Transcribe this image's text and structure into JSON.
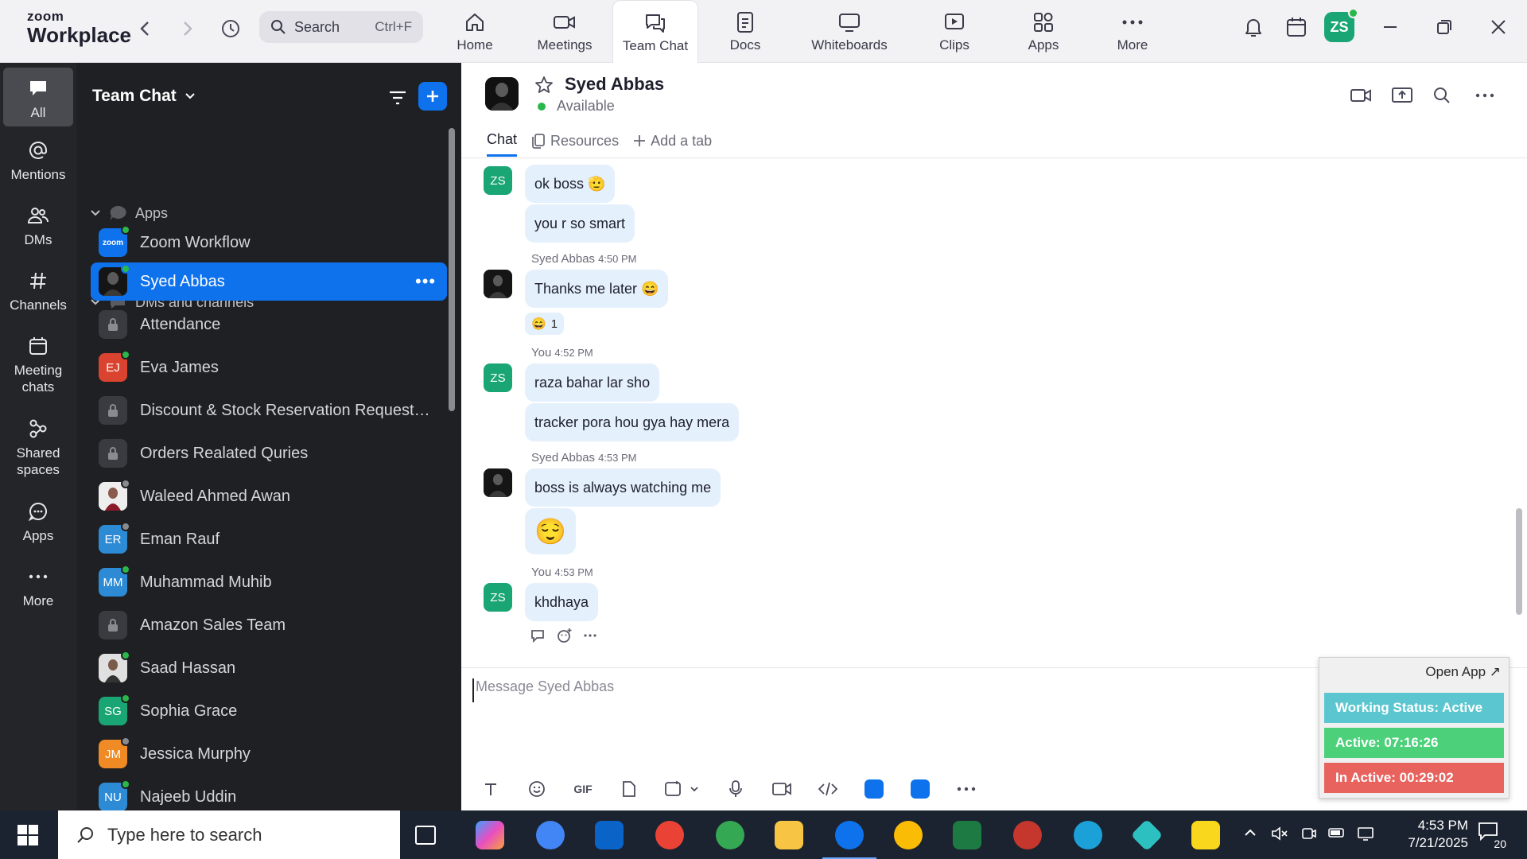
{
  "app": {
    "brand_line1": "zoom",
    "brand_line2": "Workplace",
    "search_label": "Search",
    "search_shortcut": "Ctrl+F",
    "user_initials": "ZS"
  },
  "top_tabs": [
    {
      "label": "Home",
      "icon": "home-icon"
    },
    {
      "label": "Meetings",
      "icon": "video-icon"
    },
    {
      "label": "Team Chat",
      "icon": "chat-icon",
      "active": true
    },
    {
      "label": "Docs",
      "icon": "document-icon"
    },
    {
      "label": "Whiteboards",
      "icon": "whiteboard-icon"
    },
    {
      "label": "Clips",
      "icon": "clips-icon"
    },
    {
      "label": "Apps",
      "icon": "apps-icon"
    },
    {
      "label": "More",
      "icon": "more-icon"
    }
  ],
  "rail": [
    {
      "label": "All",
      "icon": "chat-bubble-icon",
      "active": true
    },
    {
      "label": "Mentions",
      "icon": "at-icon"
    },
    {
      "label": "DMs",
      "icon": "people-icon"
    },
    {
      "label": "Channels",
      "icon": "hash-icon"
    },
    {
      "label_line1": "Meeting",
      "label_line2": "chats",
      "icon": "calendar-icon"
    },
    {
      "label_line1": "Shared",
      "label_line2": "spaces",
      "icon": "shared-icon"
    },
    {
      "label": "Apps",
      "icon": "apps-chat-icon"
    },
    {
      "label": "More",
      "icon": "ellipsis-icon"
    }
  ],
  "sidebar": {
    "title": "Team Chat",
    "apps_section": "Apps",
    "apps": [
      {
        "name": "Zoom Workflow",
        "logo_text": "zoom"
      }
    ],
    "dm_section": "DMs and channels",
    "items": [
      {
        "name": "Syed Abbas",
        "type": "photo",
        "status": "online",
        "selected": true
      },
      {
        "name": "Attendance",
        "type": "lock"
      },
      {
        "name": "Eva James",
        "initials": "EJ",
        "color": "#d9432f",
        "status": "online"
      },
      {
        "name": "Discount & Stock Reservation Requests O...",
        "type": "lock"
      },
      {
        "name": "Orders Realated Quries",
        "type": "lock"
      },
      {
        "name": "Waleed Ahmed Awan",
        "type": "photo",
        "status": "away"
      },
      {
        "name": "Eman Rauf",
        "initials": "ER",
        "color": "#2d8bd6",
        "status": "away"
      },
      {
        "name": "Muhammad Muhib",
        "initials": "MM",
        "color": "#2d8bd6",
        "status": "online"
      },
      {
        "name": "Amazon Sales Team",
        "type": "lock"
      },
      {
        "name": "Saad Hassan",
        "type": "photo",
        "status": "online"
      },
      {
        "name": "Sophia Grace",
        "initials": "SG",
        "color": "#1aa674",
        "status": "online"
      },
      {
        "name": "Jessica Murphy",
        "initials": "JM",
        "color": "#f08a24",
        "status": "away"
      },
      {
        "name": "Najeeb Uddin",
        "initials": "NU",
        "color": "#2d8bd6",
        "status": "online"
      }
    ]
  },
  "chat": {
    "contact_name": "Syed Abbas",
    "contact_status": "Available",
    "tabs": [
      "Chat",
      "Resources",
      "Add a tab"
    ],
    "messages": {
      "m1": "ok boss 🫡",
      "m2": "you r so smart",
      "sender_them": "Syed Abbas",
      "sender_me": "You",
      "t1": "4:50 PM",
      "m3": "Thanks me later 😄",
      "reaction": "😄",
      "reaction_count": "1",
      "t2": "4:52 PM",
      "m4": "raza bahar lar sho",
      "m5": "tracker pora hou gya hay mera",
      "t3": "4:53 PM",
      "m6": "boss is always watching me",
      "m7": "😌",
      "t4": "4:53 PM",
      "m8": "khdhaya"
    },
    "composer_placeholder": "Message Syed Abbas",
    "tool_gif": "GIF"
  },
  "widget": {
    "open_app": "Open App ↗",
    "working_status": "Working Status: Active",
    "active": "Active: 07:16:26",
    "inactive": "In Active: 00:29:02",
    "colors": {
      "status": "#5bc6cf",
      "active": "#4cd07a",
      "inactive": "#e8625e"
    }
  },
  "taskbar": {
    "search_placeholder": "Type here to search",
    "time": "4:53 PM",
    "date": "7/21/2025",
    "notifications": "20"
  }
}
